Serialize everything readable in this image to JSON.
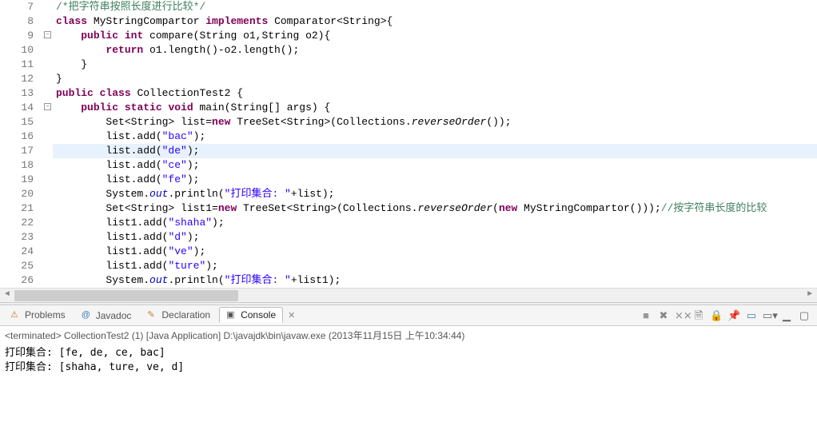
{
  "code": {
    "lines": [
      {
        "n": 7,
        "marker": "",
        "cls": "",
        "html": "<span class='com'>/*把字符串按照长度进行比较*/</span>"
      },
      {
        "n": 8,
        "marker": "",
        "cls": "",
        "html": "<span class='kw'>class</span> MyStringCompartor <span class='kw'>implements</span> Comparator&lt;String&gt;{"
      },
      {
        "n": 9,
        "marker": "fold-warn",
        "cls": "",
        "html": "    <span class='kw'>public</span> <span class='kw'>int</span> compare(String o1,String o2){"
      },
      {
        "n": 10,
        "marker": "",
        "cls": "",
        "html": "        <span class='kw'>return</span> o1.length()-o2.length();"
      },
      {
        "n": 11,
        "marker": "",
        "cls": "",
        "html": "    }"
      },
      {
        "n": 12,
        "marker": "",
        "cls": "",
        "html": "}"
      },
      {
        "n": 13,
        "marker": "",
        "cls": "",
        "html": "<span class='kw'>public</span> <span class='kw'>class</span> CollectionTest2 {"
      },
      {
        "n": 14,
        "marker": "fold",
        "cls": "",
        "html": "    <span class='kw'>public</span> <span class='kw'>static</span> <span class='kw'>void</span> main(String[] args) {"
      },
      {
        "n": 15,
        "marker": "",
        "cls": "",
        "html": "        Set&lt;String&gt; list=<span class='kw'>new</span> TreeSet&lt;String&gt;(Collections.<span class='it'>reverseOrder</span>());"
      },
      {
        "n": 16,
        "marker": "",
        "cls": "",
        "html": "        list.add(<span class='str'>\"bac\"</span>);"
      },
      {
        "n": 17,
        "marker": "",
        "cls": "highlighted",
        "html": "        list.add(<span class='str'>\"de\"</span>);"
      },
      {
        "n": 18,
        "marker": "",
        "cls": "",
        "html": "        list.add(<span class='str'>\"ce\"</span>);"
      },
      {
        "n": 19,
        "marker": "",
        "cls": "",
        "html": "        list.add(<span class='str'>\"fe\"</span>);"
      },
      {
        "n": 20,
        "marker": "",
        "cls": "",
        "html": "        System.<span class='field'>out</span>.println(<span class='str'>\"打印集合: \"</span>+list);"
      },
      {
        "n": 21,
        "marker": "",
        "cls": "",
        "html": "        Set&lt;String&gt; list1=<span class='kw'>new</span> TreeSet&lt;String&gt;(Collections.<span class='it'>reverseOrder</span>(<span class='kw'>new</span> MyStringCompartor()));<span class='com'>//按字符串长度的比较</span>"
      },
      {
        "n": 22,
        "marker": "",
        "cls": "",
        "html": "        list1.add(<span class='str'>\"shaha\"</span>);"
      },
      {
        "n": 23,
        "marker": "",
        "cls": "",
        "html": "        list1.add(<span class='str'>\"d\"</span>);"
      },
      {
        "n": 24,
        "marker": "",
        "cls": "",
        "html": "        list1.add(<span class='str'>\"ve\"</span>);"
      },
      {
        "n": 25,
        "marker": "",
        "cls": "",
        "html": "        list1.add(<span class='str'>\"ture\"</span>);"
      },
      {
        "n": 26,
        "marker": "",
        "cls": "",
        "html": "        System.<span class='field'>out</span>.println(<span class='str'>\"打印集合: \"</span>+list1);"
      }
    ]
  },
  "views": {
    "tabs": [
      {
        "label": "Problems",
        "icon": "problems-icon",
        "active": false
      },
      {
        "label": "Javadoc",
        "icon": "javadoc-icon",
        "active": false
      },
      {
        "label": "Declaration",
        "icon": "declaration-icon",
        "active": false
      },
      {
        "label": "Console",
        "icon": "console-icon",
        "active": true
      }
    ],
    "close_x": "✕"
  },
  "console": {
    "header": "<terminated> CollectionTest2 (1) [Java Application] D:\\javajdk\\bin\\javaw.exe (2013年11月15日 上午10:34:44)",
    "lines": [
      "打印集合: [fe, de, ce, bac]",
      "打印集合: [shaha, ture, ve, d]"
    ]
  }
}
